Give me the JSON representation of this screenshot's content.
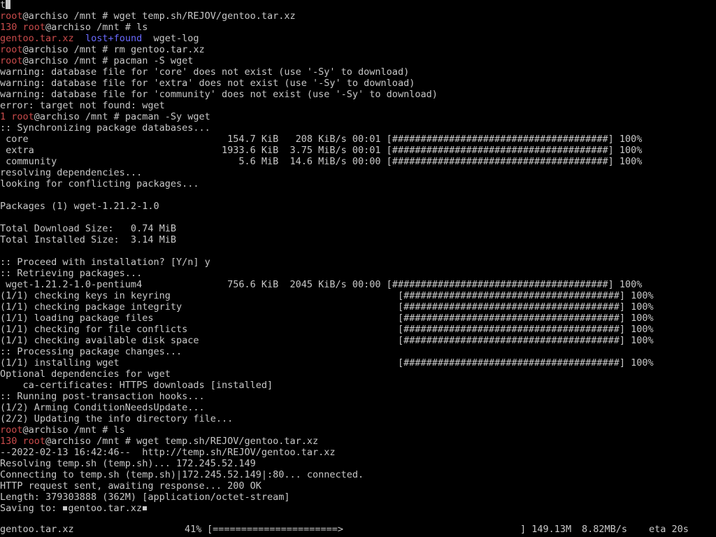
{
  "terminal": {
    "first_line": "t",
    "lines": [
      {
        "prefix": "",
        "user": "root",
        "rest": "@archiso /mnt # wget temp.sh/REJOV/gentoo.tar.xz"
      },
      {
        "prefix": "130 ",
        "user": "root",
        "rest": "@archiso /mnt # ls"
      },
      {
        "special": "ls-output",
        "file_red": "gentoo.tar.xz",
        "dir_blue": "lost+found",
        "plain": "wget-log"
      },
      {
        "prefix": "",
        "user": "root",
        "rest": "@archiso /mnt # rm gentoo.tar.xz"
      },
      {
        "prefix": "",
        "user": "root",
        "rest": "@archiso /mnt # pacman -S wget"
      },
      {
        "text": "warning: database file for 'core' does not exist (use '-Sy' to download)"
      },
      {
        "text": "warning: database file for 'extra' does not exist (use '-Sy' to download)"
      },
      {
        "text": "warning: database file for 'community' does not exist (use '-Sy' to download)"
      },
      {
        "text": "error: target not found: wget"
      },
      {
        "prefix": "1 ",
        "user": "root",
        "rest": "@archiso /mnt # pacman -Sy wget"
      },
      {
        "text": ":: Synchronizing package databases..."
      },
      {
        "text": " core                                   154.7 KiB   208 KiB/s 00:01 [######################################] 100%"
      },
      {
        "text": " extra                                 1933.6 KiB  3.75 MiB/s 00:01 [######################################] 100%"
      },
      {
        "text": " community                                5.6 MiB  14.6 MiB/s 00:00 [######################################] 100%"
      },
      {
        "text": "resolving dependencies..."
      },
      {
        "text": "looking for conflicting packages..."
      },
      {
        "text": ""
      },
      {
        "text": "Packages (1) wget-1.21.2-1.0"
      },
      {
        "text": ""
      },
      {
        "text": "Total Download Size:   0.74 MiB"
      },
      {
        "text": "Total Installed Size:  3.14 MiB"
      },
      {
        "text": ""
      },
      {
        "text": ":: Proceed with installation? [Y/n] y"
      },
      {
        "text": ":: Retrieving packages..."
      },
      {
        "text": " wget-1.21.2-1.0-pentium4               756.6 KiB  2045 KiB/s 00:00 [######################################] 100%"
      },
      {
        "text": "(1/1) checking keys in keyring                                        [######################################] 100%"
      },
      {
        "text": "(1/1) checking package integrity                                      [######################################] 100%"
      },
      {
        "text": "(1/1) loading package files                                           [######################################] 100%"
      },
      {
        "text": "(1/1) checking for file conflicts                                     [######################################] 100%"
      },
      {
        "text": "(1/1) checking available disk space                                   [######################################] 100%"
      },
      {
        "text": ":: Processing package changes..."
      },
      {
        "text": "(1/1) installing wget                                                 [######################################] 100%"
      },
      {
        "text": "Optional dependencies for wget"
      },
      {
        "text": "    ca-certificates: HTTPS downloads [installed]"
      },
      {
        "text": ":: Running post-transaction hooks..."
      },
      {
        "text": "(1/2) Arming ConditionNeedsUpdate..."
      },
      {
        "text": "(2/2) Updating the info directory file..."
      },
      {
        "prefix": "",
        "user": "root",
        "rest": "@archiso /mnt # ls"
      },
      {
        "prefix": "130 ",
        "user": "root",
        "rest": "@archiso /mnt # wget temp.sh/REJOV/gentoo.tar.xz"
      },
      {
        "text": "--2022-02-13 16:42:46--  http://temp.sh/REJOV/gentoo.tar.xz"
      },
      {
        "text": "Resolving temp.sh (temp.sh)... 172.245.52.149"
      },
      {
        "text": "Connecting to temp.sh (temp.sh)|172.245.52.149|:80... connected."
      },
      {
        "text": "HTTP request sent, awaiting response... 200 OK"
      },
      {
        "text": "Length: 379303888 (362M) [application/octet-stream]"
      },
      {
        "special": "saving",
        "label": "Saving to: ",
        "filename": "gentoo.tar.xz"
      }
    ],
    "progress": {
      "filename": "gentoo.tar.xz",
      "percent": "41%",
      "bar": "[======================>",
      "received": "] 149.13M",
      "speed": "8.82MB/s",
      "eta": "eta 20s",
      "fraction": 0.41
    },
    "colors": {
      "foreground": "#c8c8c8",
      "background": "#000000",
      "red": "#c94b4b",
      "blue": "#6a6aff"
    }
  }
}
